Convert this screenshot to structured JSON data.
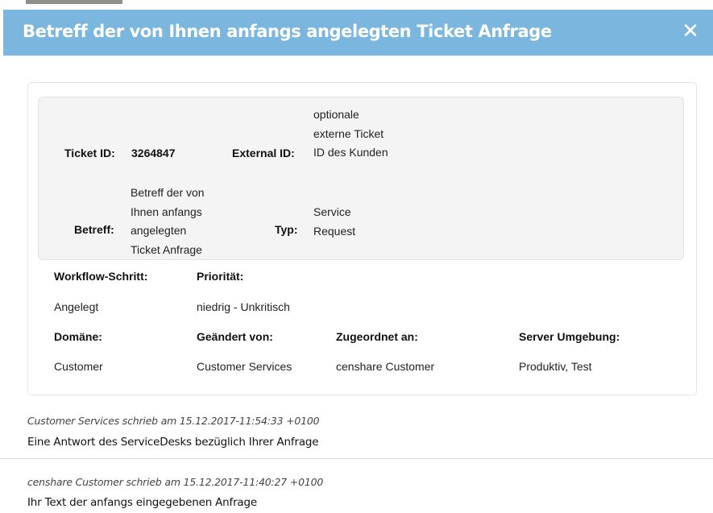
{
  "dialog": {
    "title": "Betreff der von Ihnen anfangs angelegten Ticket Anfrage",
    "close_icon": "close-icon"
  },
  "ticket": {
    "ticket_id_label": "Ticket ID:",
    "ticket_id_value": "3264847",
    "external_id_label": "External ID:",
    "external_id_lines": [
      "optionale",
      "externe Ticket",
      "ID des Kunden"
    ],
    "betreff_label": "Betreff:",
    "betreff_lines": [
      "Betreff der von",
      "Ihnen anfangs",
      "angelegten",
      "Ticket Anfrage"
    ],
    "typ_label": "Typ:",
    "typ_lines": [
      "Service",
      "Request"
    ]
  },
  "fields": {
    "workflow_label": "Workflow-Schritt:",
    "workflow_value": "Angelegt",
    "prioritaet_label": "Priorität:",
    "prioritaet_value": "niedrig - Unkritisch",
    "domaene_label": "Domäne:",
    "domaene_value": "Customer",
    "geaendert_label": "Geändert von:",
    "geaendert_value": "Customer Services",
    "zugeordnet_label": "Zugeordnet an:",
    "zugeordnet_value": "censhare Customer",
    "server_label": "Server Umgebung:",
    "server_value": "Produktiv, Test"
  },
  "messages": [
    {
      "meta": "Customer Services schrieb am 15.12.2017-11:54:33 +0100",
      "text": "Eine Antwort des ServiceDesks bezüglich Ihrer Anfrage"
    },
    {
      "meta": "censhare Customer schrieb am 15.12.2017-11:40:27 +0100",
      "text": "Ihr Text der anfangs eingegebenen Anfrage"
    }
  ]
}
